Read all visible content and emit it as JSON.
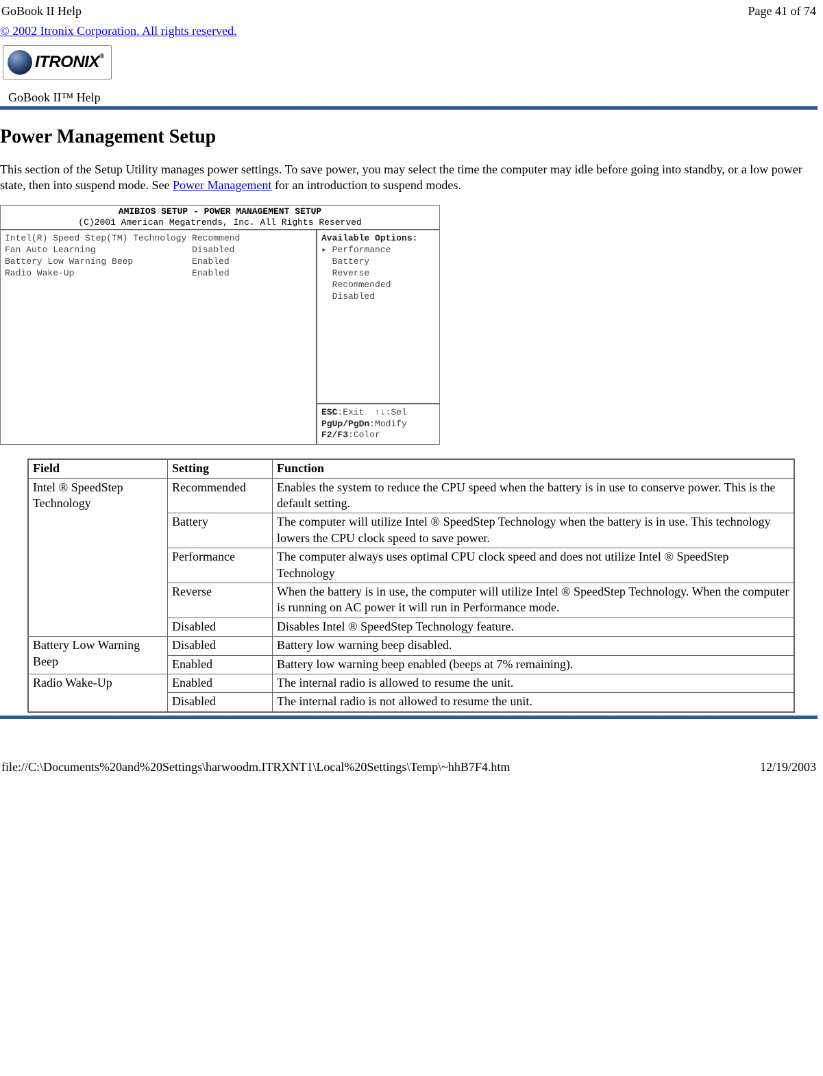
{
  "header": {
    "left": "GoBook II Help",
    "right": "Page 41 of 74"
  },
  "copyright_link": "© 2002 Itronix Corporation.  All rights reserved.",
  "logo": {
    "brand": "ITRONIX",
    "tm": "®"
  },
  "legend": "GoBook II™ Help",
  "heading": "Power Management Setup",
  "intro": {
    "pre": "This section of the Setup Utility manages power settings.  To save power, you may select the time the computer may idle before going into standby, or a low power state, then into suspend mode.  See ",
    "link": "Power Management",
    "post": " for an introduction to suspend modes."
  },
  "bios": {
    "title1": "AMIBIOS SETUP - POWER MANAGEMENT SETUP",
    "title2": "(C)2001 American Megatrends, Inc. All Rights Reserved",
    "left_rows": [
      "Intel(R) Speed Step(TM) Technology Recommend",
      "Fan Auto Learning                  Disabled",
      "Battery Low Warning Beep           Enabled",
      "Radio Wake-Up                      Enabled"
    ],
    "right_title": "Available Options:",
    "right_opts": [
      "▸ Performance",
      "  Battery",
      "  Reverse",
      "  Recommended",
      "  Disabled"
    ],
    "footer": [
      {
        "b": "ESC",
        "t": ":Exit  ↑↓:Sel"
      },
      {
        "b": "PgUp/PgDn",
        "t": ":Modify"
      },
      {
        "b": "F2/F3",
        "t": ":Color"
      }
    ]
  },
  "table": {
    "headers": [
      "Field",
      "Setting",
      "Function"
    ],
    "groups": [
      {
        "field": "Intel ® SpeedStep Technology",
        "rows": [
          {
            "setting": "Recommended",
            "function": "Enables the system to reduce the CPU speed when the battery is in use to conserve power. This is the default setting."
          },
          {
            "setting": "Battery",
            "function": "The computer will utilize Intel ® SpeedStep Technology when the battery is in use.  This technology lowers the CPU clock speed to save power."
          },
          {
            "setting": "Performance",
            "function": "The computer always uses optimal CPU clock speed and does not utilize Intel ® SpeedStep Technology"
          },
          {
            "setting": "Reverse",
            "function": "When the battery is in use, the computer will utilize Intel ® SpeedStep Technology.  When the computer is running on AC power it will run in Performance mode."
          },
          {
            "setting": "Disabled",
            "function": "Disables Intel ® SpeedStep Technology feature."
          }
        ]
      },
      {
        "field": "Battery Low Warning Beep",
        "rows": [
          {
            "setting": "Disabled",
            "function": "Battery low warning beep disabled."
          },
          {
            "setting": "Enabled",
            "function": "Battery low warning beep enabled (beeps at 7% remaining)."
          }
        ]
      },
      {
        "field": "Radio Wake-Up",
        "rows": [
          {
            "setting": "Enabled",
            "function": "The internal radio is allowed to resume the unit."
          },
          {
            "setting": "Disabled",
            "function": "The internal radio is not allowed to resume the unit."
          }
        ]
      }
    ]
  },
  "footer": {
    "path": "file://C:\\Documents%20and%20Settings\\harwoodm.ITRXNT1\\Local%20Settings\\Temp\\~hhB7F4.htm",
    "date": "12/19/2003"
  }
}
